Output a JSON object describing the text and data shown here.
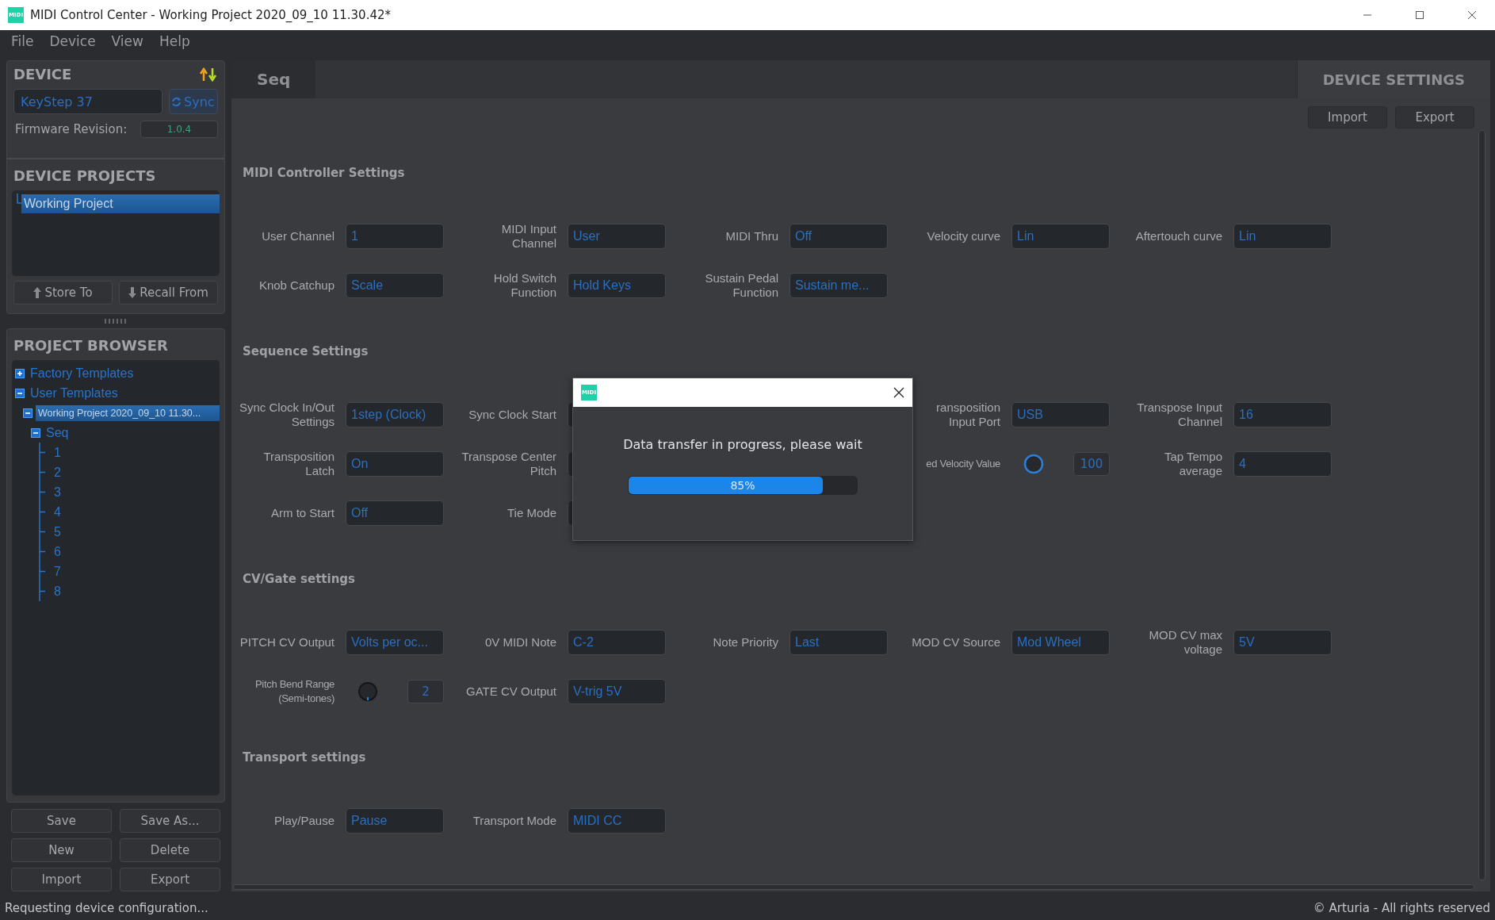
{
  "window": {
    "icon_text": "MIDI",
    "title": "MIDI Control Center - Working Project 2020_09_10 11.30.42*"
  },
  "menu": [
    "File",
    "Device",
    "View",
    "Help"
  ],
  "device": {
    "heading": "DEVICE",
    "name": "KeyStep 37",
    "sync": "Sync",
    "firmware_label": "Firmware Revision:",
    "firmware": "1.0.4"
  },
  "device_projects": {
    "heading": "DEVICE PROJECTS",
    "items": [
      {
        "label": "Working Project",
        "selected": true
      }
    ],
    "buttons": [
      "Store To",
      "Recall From"
    ]
  },
  "project_browser": {
    "heading": "PROJECT BROWSER",
    "tree": [
      {
        "label": "Factory Templates",
        "expanded": false,
        "selected": false
      },
      {
        "label": "User Templates",
        "expanded": true,
        "selected": false,
        "children": [
          {
            "label": "Working Project 2020_09_10 11.30...",
            "expanded": true,
            "selected": true,
            "children": [
              {
                "label": "Seq",
                "expanded": true,
                "selected": false,
                "children": [
                  {
                    "label": "1",
                    "selected": false
                  },
                  {
                    "label": "2",
                    "selected": false
                  },
                  {
                    "label": "3",
                    "selected": false
                  },
                  {
                    "label": "4",
                    "selected": false
                  },
                  {
                    "label": "5",
                    "selected": false
                  },
                  {
                    "label": "6",
                    "selected": false
                  },
                  {
                    "label": "7",
                    "selected": false
                  },
                  {
                    "label": "8",
                    "selected": false
                  }
                ]
              }
            ]
          }
        ]
      }
    ],
    "buttons": [
      "Save",
      "Save As...",
      "New",
      "Delete",
      "Import",
      "Export"
    ]
  },
  "tabs": [
    {
      "label": "Seq",
      "kind": "page",
      "selected": true
    },
    {
      "label": "DEVICE SETTINGS",
      "kind": "settings",
      "selected": false
    }
  ],
  "toolbar_buttons": [
    "Import",
    "Export"
  ],
  "sections": [
    {
      "title": "MIDI Controller Settings",
      "rows": [
        [
          {
            "label": "User Channel",
            "kind": "select",
            "value": "1"
          },
          {
            "label": "MIDI Input Channel",
            "kind": "select",
            "value": "User"
          },
          {
            "label": "MIDI Thru",
            "kind": "select",
            "value": "Off"
          },
          {
            "label": "Velocity curve",
            "kind": "select",
            "value": "Lin"
          },
          {
            "label": "Aftertouch curve",
            "kind": "select",
            "value": "Lin"
          }
        ],
        [
          {
            "label": "Knob Catchup",
            "kind": "select",
            "value": "Scale"
          },
          {
            "label": "Hold Switch\nFunction",
            "kind": "select",
            "value": "Hold Keys"
          },
          {
            "label": "Sustain Pedal\nFunction",
            "kind": "select",
            "value": "Sustain me..."
          }
        ]
      ]
    },
    {
      "title": "Sequence Settings",
      "rows": [
        [
          {
            "label": "Sync Clock In/Out\nSettings",
            "kind": "select",
            "value": "1step (Clock)"
          },
          {
            "label": "Sync Clock Start",
            "kind": "covered"
          },
          {
            "kind": "blank"
          },
          {
            "label": "ransposition\nInput Port",
            "kind": "select",
            "value": "USB"
          },
          {
            "label": "Transpose Input\nChannel",
            "kind": "select",
            "value": "16"
          }
        ],
        [
          {
            "label": "Transposition Latch",
            "kind": "select",
            "value": "On"
          },
          {
            "label": "Transpose Center\nPitch",
            "kind": "covered"
          },
          {
            "kind": "blank"
          },
          {
            "label": "ed Velocity Value",
            "kind": "knob",
            "active": true,
            "value": "100"
          },
          {
            "label": "Tap Tempo average",
            "kind": "select",
            "value": "4"
          }
        ],
        [
          {
            "label": "Arm to Start",
            "kind": "select",
            "value": "Off"
          },
          {
            "label": "Tie Mode",
            "kind": "covered"
          }
        ]
      ]
    },
    {
      "title": "CV/Gate settings",
      "rows": [
        [
          {
            "label": "PITCH CV Output",
            "kind": "select",
            "value": "Volts per oc..."
          },
          {
            "label": "0V MIDI Note",
            "kind": "select",
            "value": "C-2"
          },
          {
            "label": "Note Priority",
            "kind": "select",
            "value": "Last"
          },
          {
            "label": "MOD CV Source",
            "kind": "select",
            "value": "Mod Wheel"
          },
          {
            "label": "MOD CV max\nvoltage",
            "kind": "select",
            "value": "5V"
          }
        ],
        [
          {
            "label": "Pitch Bend Range\n(Semi-tones)",
            "kind": "knob",
            "active": false,
            "value": "2"
          },
          {
            "label": "GATE CV Output",
            "kind": "select",
            "value": "V-trig 5V"
          }
        ]
      ]
    },
    {
      "title": "Transport settings",
      "rows": [
        [
          {
            "label": "Play/Pause",
            "kind": "select",
            "value": "Pause"
          },
          {
            "label": "Transport Mode",
            "kind": "select",
            "value": "MIDI CC"
          }
        ]
      ]
    }
  ],
  "dialog": {
    "icon_text": "MIDI",
    "message": "Data transfer in progress, please wait",
    "progress": {
      "level": 0.85,
      "reading": "85%"
    }
  },
  "status_bar": {
    "left": "Requesting device configuration...",
    "right": "© Arturia - All rights reserved"
  }
}
